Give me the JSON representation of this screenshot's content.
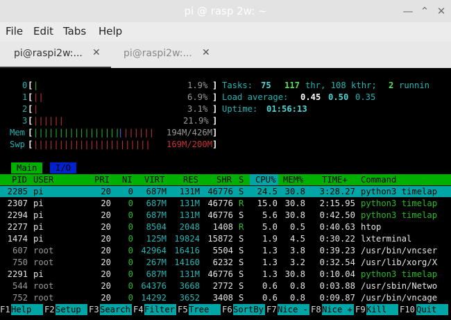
{
  "window": {
    "title": "pi @ rasp 2w: ~"
  },
  "menubar": [
    "File",
    "Edit",
    "Tabs",
    "Help"
  ],
  "tabs": [
    {
      "label": "pi@raspi2w:...",
      "active": true
    },
    {
      "label": "pi@raspi2w:...",
      "active": false
    }
  ],
  "meters": {
    "cpu": [
      {
        "label": "0",
        "bar": "|",
        "pct": "1.9%"
      },
      {
        "label": "1",
        "bar": "||",
        "pct": "6.9%"
      },
      {
        "label": "2",
        "bar": "|",
        "pct": "3.1%"
      },
      {
        "label": "3",
        "bar": "||||||",
        "pct": "21.9%"
      }
    ],
    "mem": {
      "label": "Mem",
      "bar": "|||||||||||||||||",
      "bar2": "||||||",
      "value": "194M/426M"
    },
    "swp": {
      "label": "Swp",
      "bar": "|||||||||||||||||||||||",
      "value": "169M/200M"
    }
  },
  "summary": {
    "tasks_label": "Tasks: ",
    "tasks": "75",
    "thr": "117",
    "kthr_text": "thr, 108 kthr;",
    "running": "2",
    "running_label": "runnin",
    "load_label": "Load average: ",
    "load1": "0.45",
    "load5": "0.50",
    "load15": "0.35",
    "uptime_label": "Uptime: ",
    "uptime": "01:56:13"
  },
  "screen_tabs": [
    "Main",
    "I/O"
  ],
  "columns": [
    "PID",
    "USER",
    "PRI",
    "NI",
    "VIRT",
    "RES",
    "SHR",
    "S",
    "CPU%",
    "MEM%",
    "TIME+",
    "Command"
  ],
  "processes": [
    {
      "pid": "2285",
      "user": "pi",
      "pri": "20",
      "ni": "0",
      "virt": "687M",
      "res": "131M",
      "shr": "46776",
      "s": "S",
      "cpu": "24.5",
      "mem": "30.8",
      "time": "3:28.27",
      "cmd": "python3 timelap",
      "selected": true,
      "thread": false
    },
    {
      "pid": "2307",
      "user": "pi",
      "pri": "20",
      "ni": "0",
      "virt": "687M",
      "res": "131M",
      "shr": "46776",
      "s": "R",
      "cpu": "15.0",
      "mem": "30.8",
      "time": "2:15.95",
      "cmd": "python3 timelap",
      "selected": false,
      "thread": true
    },
    {
      "pid": "2294",
      "user": "pi",
      "pri": "20",
      "ni": "0",
      "virt": "687M",
      "res": "131M",
      "shr": "46776",
      "s": "S",
      "cpu": "5.6",
      "mem": "30.8",
      "time": "0:42.50",
      "cmd": "python3 timelap",
      "selected": false,
      "thread": true
    },
    {
      "pid": "2277",
      "user": "pi",
      "pri": "20",
      "ni": "0",
      "virt": "8504",
      "res": "2048",
      "shr": "1408",
      "s": "R",
      "cpu": "5.0",
      "mem": "0.5",
      "time": "0:40.63",
      "cmd": "htop",
      "selected": false,
      "thread": false
    },
    {
      "pid": "1474",
      "user": "pi",
      "pri": "20",
      "ni": "0",
      "virt": "125M",
      "res": "19824",
      "shr": "15872",
      "s": "S",
      "cpu": "1.9",
      "mem": "4.5",
      "time": "0:30.22",
      "cmd": "lxterminal",
      "selected": false,
      "thread": false
    },
    {
      "pid": "607",
      "user": "root",
      "pri": "20",
      "ni": "0",
      "virt": "42964",
      "res": "16416",
      "shr": "5504",
      "s": "S",
      "cpu": "1.3",
      "mem": "3.8",
      "time": "0:39.23",
      "cmd": "/usr/bin/vncser",
      "selected": false,
      "thread": false
    },
    {
      "pid": "750",
      "user": "root",
      "pri": "20",
      "ni": "0",
      "virt": "267M",
      "res": "14160",
      "shr": "6232",
      "s": "S",
      "cpu": "1.3",
      "mem": "3.2",
      "time": "0:32.54",
      "cmd": "/usr/lib/xorg/X",
      "selected": false,
      "thread": false
    },
    {
      "pid": "2291",
      "user": "pi",
      "pri": "20",
      "ni": "0",
      "virt": "687M",
      "res": "131M",
      "shr": "46776",
      "s": "S",
      "cpu": "1.3",
      "mem": "30.8",
      "time": "0:10.04",
      "cmd": "python3 timelap",
      "selected": false,
      "thread": true
    },
    {
      "pid": "544",
      "user": "root",
      "pri": "20",
      "ni": "0",
      "virt": "64376",
      "res": "3668",
      "shr": "2772",
      "s": "S",
      "cpu": "0.6",
      "mem": "0.8",
      "time": "0:03.88",
      "cmd": "/usr/sbin/Netwo",
      "selected": false,
      "thread": false
    },
    {
      "pid": "752",
      "user": "root",
      "pri": "20",
      "ni": "0",
      "virt": "14292",
      "res": "3652",
      "shr": "3408",
      "s": "S",
      "cpu": "0.6",
      "mem": "0.8",
      "time": "0:09.87",
      "cmd": "/usr/bin/vncage",
      "selected": false,
      "thread": false
    }
  ],
  "function_keys": [
    {
      "key": "F1",
      "label": "Help"
    },
    {
      "key": "F2",
      "label": "Setup"
    },
    {
      "key": "F3",
      "label": "Search"
    },
    {
      "key": "F4",
      "label": "Filter"
    },
    {
      "key": "F5",
      "label": "Tree"
    },
    {
      "key": "F6",
      "label": "SortBy"
    },
    {
      "key": "F7",
      "label": "Nice -"
    },
    {
      "key": "F8",
      "label": "Nice +"
    },
    {
      "key": "F9",
      "label": "Kill"
    },
    {
      "key": "F10",
      "label": "Quit"
    }
  ],
  "colors": {
    "header_bg": "#00b000",
    "selected_bg": "#00a5a5",
    "terminal_bg": "#000000"
  }
}
